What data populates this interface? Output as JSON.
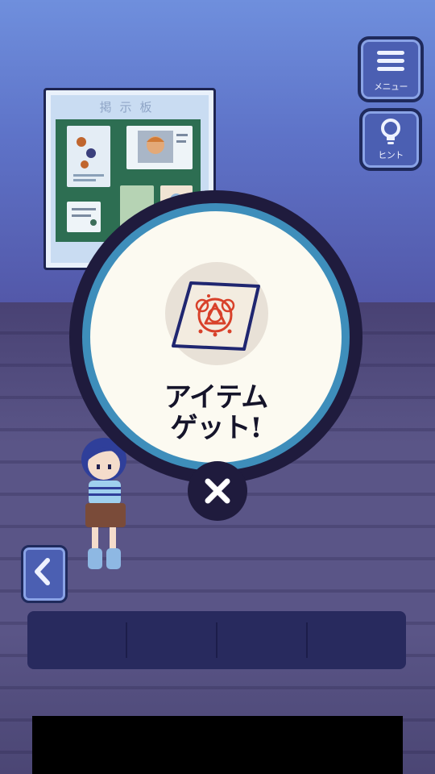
{
  "ui": {
    "menu_label": "メニュー",
    "hint_label": "ヒント"
  },
  "bulletin_board": {
    "title": "掲示板",
    "footer": "♥♥♥♥♥"
  },
  "popup": {
    "line1": "アイテム",
    "line2": "ゲット!",
    "item_icon": "cloth-with-red-symbol-icon",
    "close_icon": "close-icon"
  },
  "colors": {
    "wall_top": "#6f8fdd",
    "floor": "#5a5587",
    "button_fill": "#4b5fb2",
    "popup_ring": "#3e8ebb",
    "popup_inner": "#fcfaf1",
    "item_symbol": "#d8412a"
  }
}
